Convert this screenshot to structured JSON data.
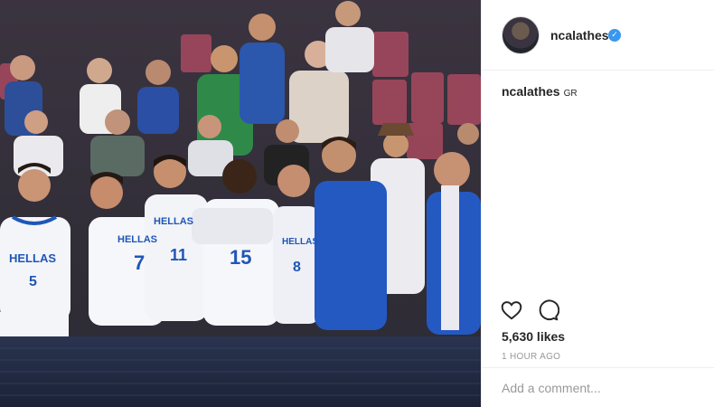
{
  "post": {
    "photo_alt": "Greek national basketball team players celebrating at courtside",
    "jersey_text": "HELLAS",
    "jersey_numbers": [
      "5",
      "7",
      "11",
      "15",
      "8"
    ]
  },
  "header": {
    "username": "ncalathes",
    "verified_icon": "verified-badge-icon"
  },
  "caption": {
    "username": "ncalathes",
    "text": "GR"
  },
  "actions": {
    "like_icon": "heart-icon",
    "comment_icon": "comment-icon"
  },
  "likes": "5,630 likes",
  "timestamp": "1 HOUR AGO",
  "comment": {
    "placeholder": "Add a comment..."
  },
  "colors": {
    "accent": "#3897f0",
    "jersey_blue": "#1f56b8",
    "text": "#262626",
    "muted": "#999999"
  }
}
